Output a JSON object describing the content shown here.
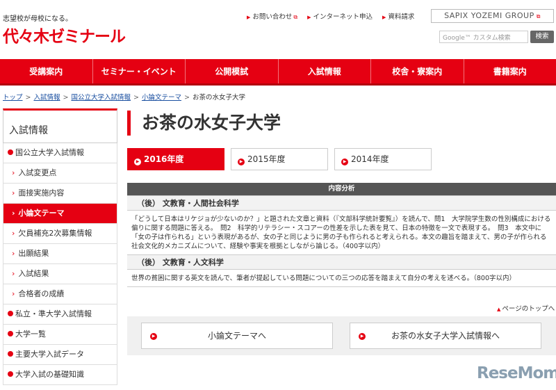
{
  "header": {
    "tagline": "志望校が母校になる。",
    "logo": "代々木ゼミナール",
    "links": [
      "お問い合わせ",
      "インターネット申込",
      "資料請求"
    ],
    "group": "SAPIX YOZEMI GROUP",
    "search_placeholder": "Google™ カスタム検索",
    "search_button": "検索"
  },
  "nav": [
    "受講案内",
    "セミナー・イベント",
    "公開模試",
    "入試情報",
    "校舎・寮案内",
    "書籍案内"
  ],
  "breadcrumb": {
    "items": [
      "トップ",
      "入試情報",
      "国公立大学入試情報",
      "小論文テーマ"
    ],
    "current": "お茶の水女子大学"
  },
  "sidebar": {
    "title": "入試情報",
    "items": [
      {
        "label": "国公立大学入試情報"
      },
      {
        "label": "入試変更点"
      },
      {
        "label": "面接実施内容"
      },
      {
        "label": "小論文テーマ"
      },
      {
        "label": "欠員補充2次募集情報"
      },
      {
        "label": "出願結果"
      },
      {
        "label": "入試結果"
      },
      {
        "label": "合格者の成績"
      },
      {
        "label": "私立・準大学入試情報"
      },
      {
        "label": "大学一覧"
      },
      {
        "label": "主要大学入試データ"
      },
      {
        "label": "大学入試の基礎知識"
      }
    ]
  },
  "main": {
    "title": "お茶の水女子大学",
    "tabs": [
      "2016年度",
      "2015年度",
      "2014年度"
    ],
    "table_header": "内容分析",
    "sections": [
      {
        "heading": "（後） 文教育・人間社会科学",
        "text": "「どうして日本はリケジョが少ないのか？」と題された文章と資料（『文部科学統計要覧』）を読んで、問1　大学院学生数の性別構成における偏りに関する問題に答える。　問2　科学的リテラシー・スコアーの性差を示した表を見て、日本の特徴を一文で表現する。　問3　本文中に「女の子は作られる」という表現があるが、女の子と同じように男の子も作られると考えられる。本文の趣旨を踏まえて、男の子が作られる社会文化的メカニズムについて、経験や事実を根拠としながら論じる。（400字以内）"
      },
      {
        "heading": "（後） 文教育・人文科学",
        "text": "世界の貧困に関する英文を読んで、筆者が提起している問題についての三つの応答を踏まえて自分の考えを述べる。（800字以内）"
      }
    ],
    "page_top": "ページのトップへ",
    "buttons": [
      "小論文テーマへ",
      "お茶の水女子大学入試情報へ"
    ]
  },
  "watermark": "ReseMom"
}
